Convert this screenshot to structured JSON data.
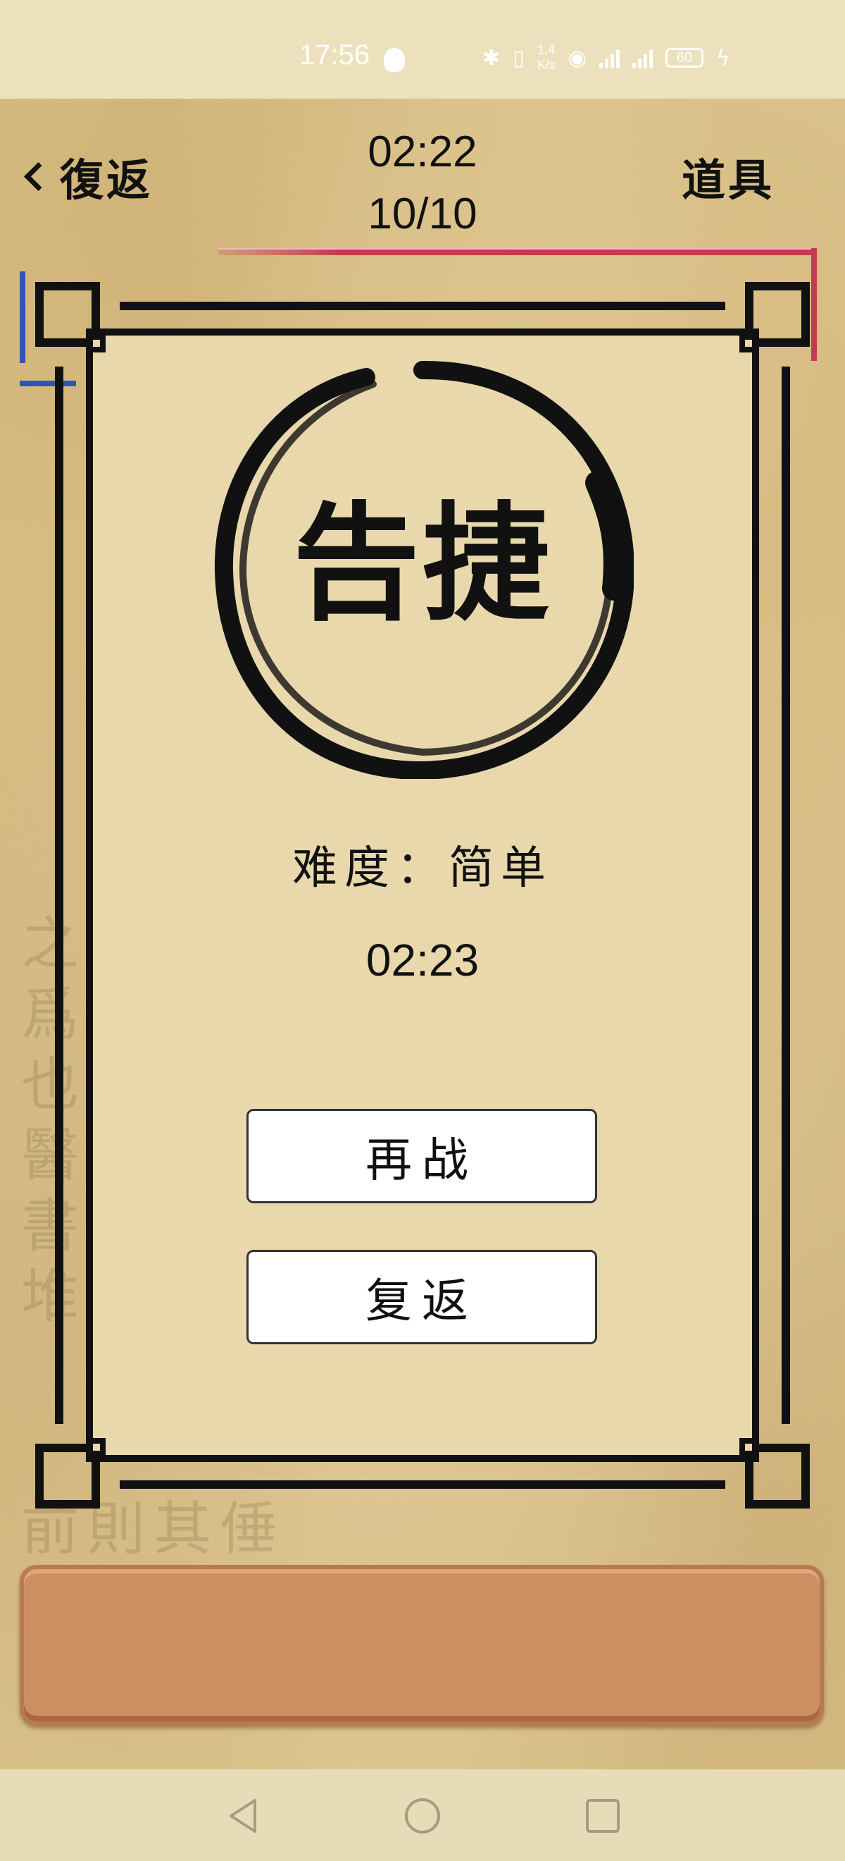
{
  "status_bar": {
    "time": "17:56",
    "network_speed_value": "1.4",
    "network_speed_unit": "K/s",
    "battery": "60",
    "icons": [
      "notification-icon",
      "bluetooth-icon",
      "vibrate-icon",
      "hotspot-icon",
      "signal-4g-icon",
      "signal-4g-icon",
      "battery-icon",
      "charging-icon"
    ]
  },
  "header": {
    "back_label": "復返",
    "timer": "02:22",
    "progress": "10/10",
    "tools_label": "道具"
  },
  "result_dialog": {
    "title": "告捷",
    "difficulty": "难度：简单",
    "time": "02:23",
    "retry_label": "再战",
    "return_label": "复返"
  },
  "background": {
    "watermark_columns": [
      "之爲也醫書堆",
      "前則其倕"
    ]
  },
  "colors": {
    "ink": "#111111",
    "panel": "#e8d8ac",
    "wood": "#cc8f62",
    "accent_red": "#c43a52",
    "accent_blue": "#3252b8"
  },
  "nav_bar": {
    "icons": [
      "back-triangle-icon",
      "home-circle-icon",
      "recents-square-icon"
    ]
  }
}
